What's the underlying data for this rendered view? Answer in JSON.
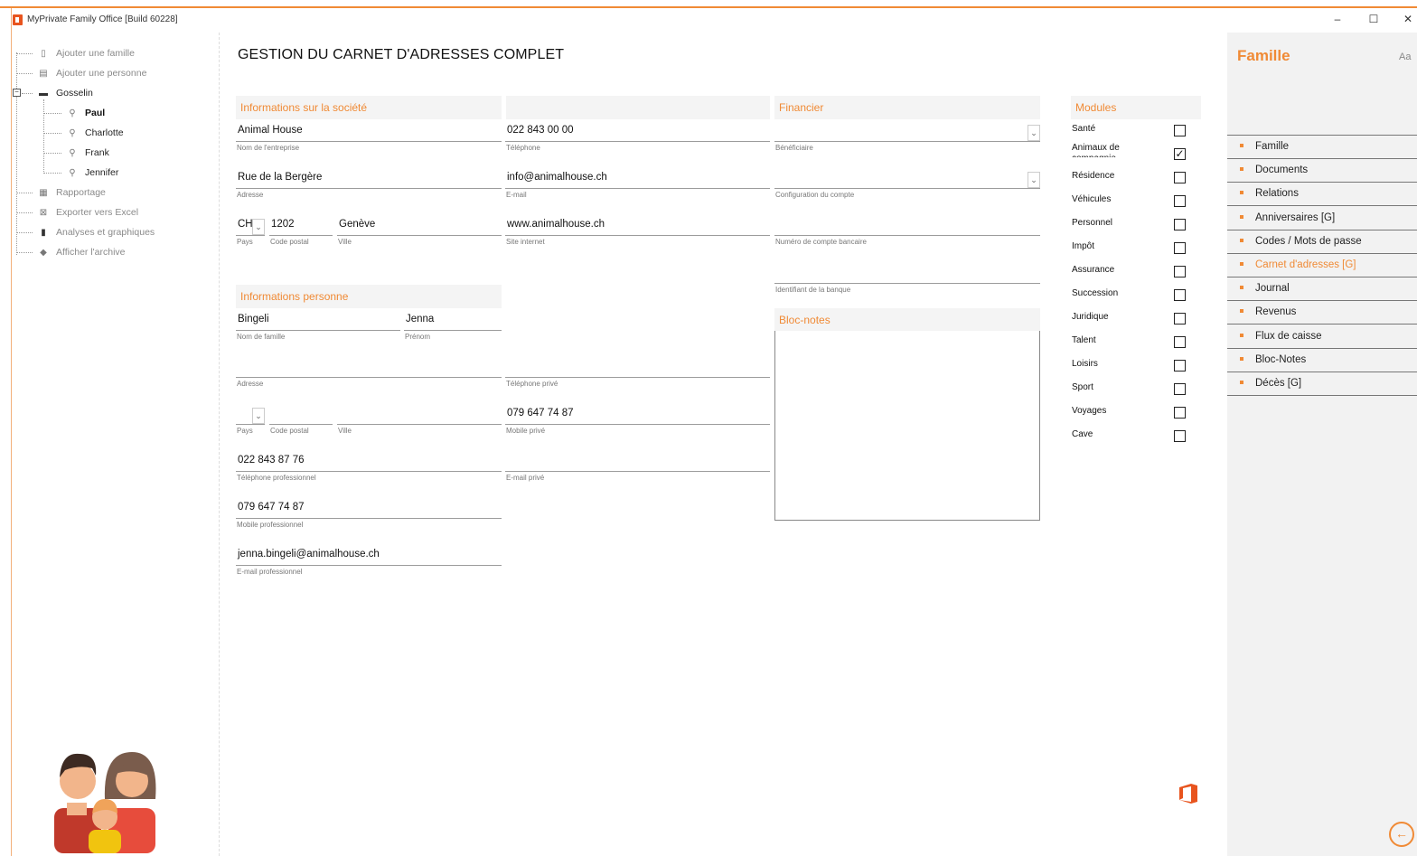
{
  "window": {
    "title": "MyPrivate Family Office [Build 60228]",
    "minimize_glyph": "–",
    "maximize_glyph": "☐",
    "close_glyph": "✕"
  },
  "tree": {
    "add_family": "Ajouter une famille",
    "add_person": "Ajouter une personne",
    "family_name": "Gosselin",
    "members": [
      "Paul",
      "Charlotte",
      "Frank",
      "Jennifer"
    ],
    "reporting": "Rapportage",
    "export_excel": "Exporter vers Excel",
    "analyses": "Analyses et graphiques",
    "archive": "Afficher l'archive"
  },
  "main": {
    "page_title": "GESTION DU CARNET D'ADRESSES COMPLET",
    "company_section": "Informations sur la société",
    "financier_section": "Financier",
    "person_section": "Informations personne",
    "notes_section": "Bloc-notes",
    "company": {
      "name": "Animal House",
      "name_label": "Nom de l'entreprise",
      "address": "Rue de la Bergère",
      "address_label": "Adresse",
      "country": "CH",
      "country_label": "Pays",
      "zip": "1202",
      "zip_label": "Code postal",
      "city": "Genève",
      "city_label": "Ville",
      "phone": "022 843 00 00",
      "phone_label": "Téléphone",
      "email": "info@animalhouse.ch",
      "email_label": "E-mail",
      "website": "www.animalhouse.ch",
      "website_label": "Site internet"
    },
    "financier": {
      "beneficiary_label": "Bénéficiaire",
      "account_config_label": "Configuration du compte",
      "bank_account_label": "Numéro de compte bancaire",
      "bank_id_label": "Identifiant de la banque"
    },
    "person": {
      "lastname": "Bingeli",
      "lastname_label": "Nom de famille",
      "firstname": "Jenna",
      "firstname_label": "Prénom",
      "address_label": "Adresse",
      "private_phone_label": "Téléphone privé",
      "country_label": "Pays",
      "zip_label": "Code postal",
      "city_label": "Ville",
      "private_mobile": "079 647 74 87",
      "private_mobile_label": "Mobile privé",
      "work_phone": "022 843 87 76",
      "work_phone_label": "Téléphone professionnel",
      "private_email_label": "E-mail privé",
      "work_mobile": "079 647 74 87",
      "work_mobile_label": "Mobile professionnel",
      "work_email": "jenna.bingeli@animalhouse.ch",
      "work_email_label": "E-mail professionnel"
    }
  },
  "modules": {
    "title": "Modules",
    "items": [
      {
        "name": "Santé",
        "checked": false
      },
      {
        "name": "Animaux de compagnie",
        "checked": true
      },
      {
        "name": "Résidence",
        "checked": false
      },
      {
        "name": "Véhicules",
        "checked": false
      },
      {
        "name": "Personnel",
        "checked": false
      },
      {
        "name": "Impôt",
        "checked": false
      },
      {
        "name": "Assurance",
        "checked": false
      },
      {
        "name": "Succession",
        "checked": false
      },
      {
        "name": "Juridique",
        "checked": false
      },
      {
        "name": "Talent",
        "checked": false
      },
      {
        "name": "Loisirs",
        "checked": false
      },
      {
        "name": "Sport",
        "checked": false
      },
      {
        "name": "Voyages",
        "checked": false
      },
      {
        "name": "Cave",
        "checked": false
      }
    ]
  },
  "right_panel": {
    "title": "Famille",
    "font_toggle": "Aa",
    "items": [
      "Famille",
      "Documents",
      "Relations",
      "Anniversaires [G]",
      "Codes / Mots de passe",
      "Carnet d'adresses [G]",
      "Journal",
      "Revenus",
      "Flux de caisse",
      "Bloc-Notes",
      "Décès [G]"
    ],
    "active_index": 5
  },
  "colors": {
    "accent": "#f08a35",
    "office_red": "#e8541e"
  }
}
